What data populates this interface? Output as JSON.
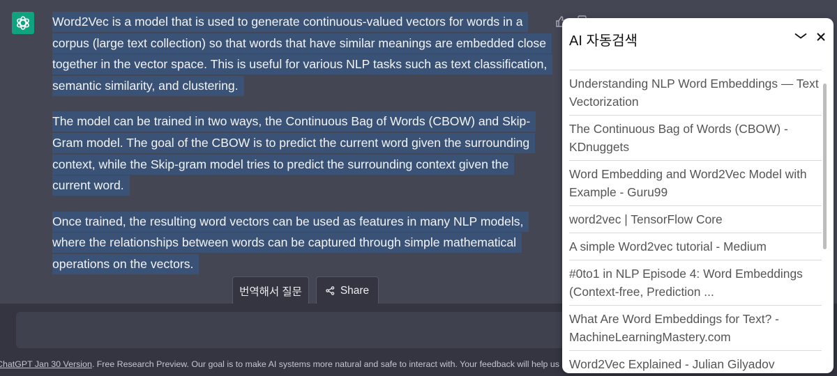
{
  "message": {
    "paragraphs": [
      "Word2Vec is a model that is used to generate continuous-valued vectors for words in a corpus (large text collection) so that words that have similar meanings are embedded close together in the vector space. This is useful for various NLP tasks such as text classification, semantic similarity, and clustering.",
      "The model can be trained in two ways, the Continuous Bag of Words (CBOW) and Skip-Gram model. The goal of the CBOW is to predict the current word given the surrounding context, while the Skip-gram model tries to predict the surrounding context given the current word.",
      "Once trained, the resulting word vectors can be used as features in many NLP models, where the relationships between words can be captured through simple mathematical operations on the vectors."
    ]
  },
  "actions": {
    "translate_label": "번역해서 질문",
    "share_label": "Share"
  },
  "footer": {
    "version_link": "ChatGPT Jan 30 Version",
    "text": ". Free Research Preview. Our goal is to make AI systems more natural and safe to interact with. Your feedback will help us improve."
  },
  "search_panel": {
    "title": "AI 자동검색",
    "results": [
      "Understanding NLP Word Embeddings — Text Vectorization",
      "The Continuous Bag of Words (CBOW) - KDnuggets",
      "Word Embedding and Word2Vec Model with Example - Guru99",
      "word2vec | TensorFlow Core",
      "A simple Word2vec tutorial - Medium",
      "#0to1 in NLP Episode 4: Word Embeddings (Context-free, Prediction ...",
      "What Are Word Embeddings for Text? - MachineLearningMastery.com",
      "Word2Vec Explained - Julian Gilyadov"
    ]
  },
  "colors": {
    "chat_bg": "#444654",
    "highlight": "#3a5275",
    "avatar": "#10a37f",
    "footer_bg": "#343541"
  },
  "icons": [
    "openai-logo-icon",
    "thumbs-up-icon",
    "copy-icon",
    "share-icon",
    "chevron-down-icon",
    "close-icon"
  ]
}
